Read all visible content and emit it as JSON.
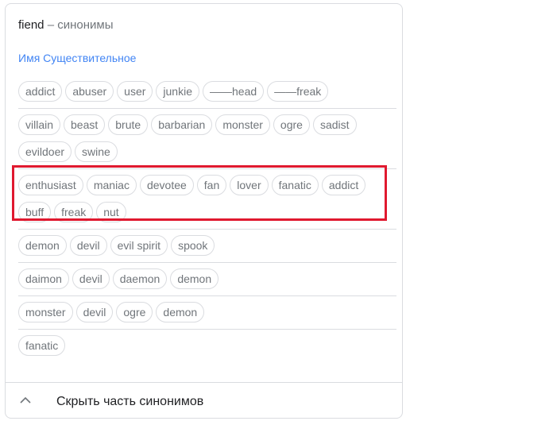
{
  "header": {
    "word": "fiend",
    "separator": "–",
    "subtitle": "синонимы"
  },
  "part_of_speech": "Имя Существительное",
  "groups": [
    [
      "addict",
      "abuser",
      "user",
      "junkie",
      "——head",
      "——freak"
    ],
    [
      "villain",
      "beast",
      "brute",
      "barbarian",
      "monster",
      "ogre",
      "sadist",
      "evildoer",
      "swine"
    ],
    [
      "enthusiast",
      "maniac",
      "devotee",
      "fan",
      "lover",
      "fanatic",
      "addict",
      "buff",
      "freak",
      "nut"
    ],
    [
      "demon",
      "devil",
      "evil spirit",
      "spook"
    ],
    [
      "daimon",
      "devil",
      "daemon",
      "demon"
    ],
    [
      "monster",
      "devil",
      "ogre",
      "demon"
    ],
    [
      "fanatic"
    ]
  ],
  "footer": {
    "toggle_label": "Скрыть часть синонимов",
    "toggle_icon": "chevron-up-icon"
  },
  "colors": {
    "accent": "#4285f4",
    "highlight": "#e0192f",
    "border": "#dadce0",
    "chip_text": "#70757a"
  }
}
